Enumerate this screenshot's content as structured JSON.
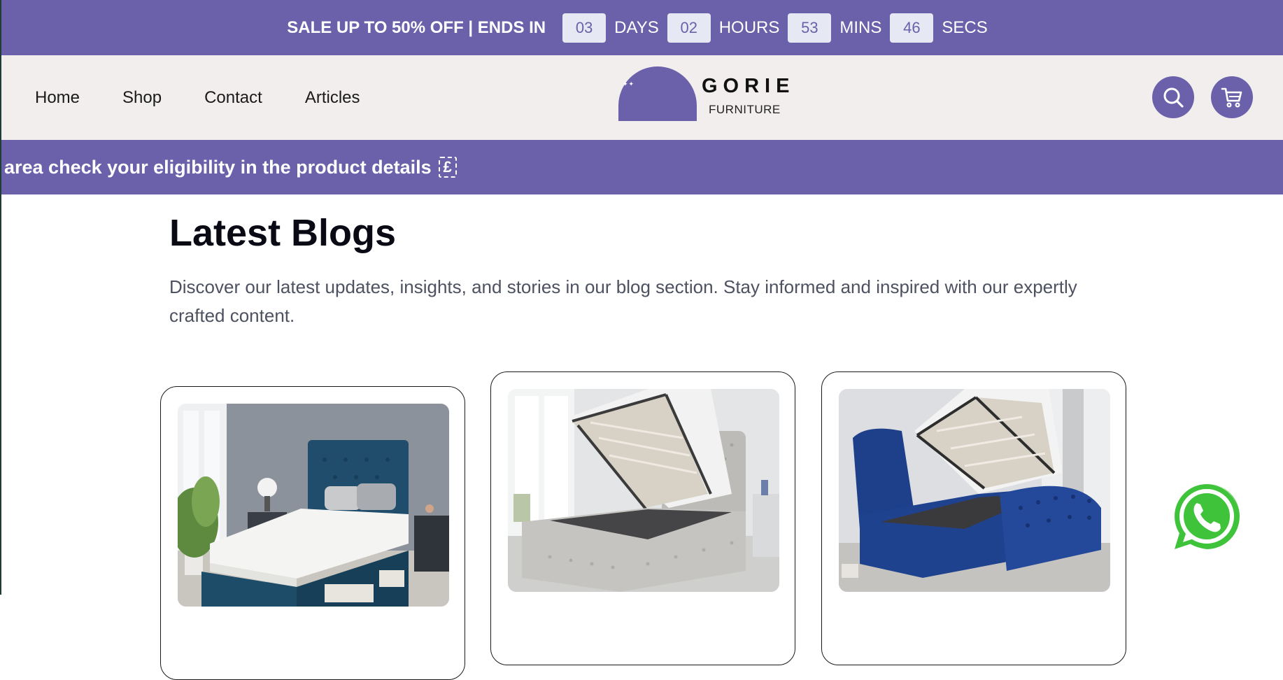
{
  "colors": {
    "brand": "#6b61aa",
    "header_bg": "#f2eeee",
    "timer_box": "#e6e8f3",
    "whatsapp": "#3ec33a"
  },
  "promo": {
    "title": "SALE UP TO 50% OFF | ENDS IN",
    "timer": [
      {
        "value": "03",
        "unit": "DAYS"
      },
      {
        "value": "02",
        "unit": "HOURS"
      },
      {
        "value": "53",
        "unit": "MINS"
      },
      {
        "value": "46",
        "unit": "SECS"
      }
    ]
  },
  "nav": {
    "items": [
      "Home",
      "Shop",
      "Contact",
      "Articles"
    ]
  },
  "logo": {
    "name": "GORIE",
    "sub": "FURNITURE"
  },
  "header_icons": [
    "search-icon",
    "cart-icon"
  ],
  "marquee": {
    "text": "area check your eligibility in the product details",
    "icon": "pound-icon"
  },
  "blog": {
    "title": "Latest Blogs",
    "description": "Discover our latest updates, insights, and stories in our blog section. Stay informed and inspired with our expertly crafted content.",
    "cards": [
      {
        "image": "blue-divan-bed-with-mattress"
      },
      {
        "image": "grey-ottoman-storage-bed-open"
      },
      {
        "image": "blue-chesterfield-ottoman-bed-open"
      }
    ]
  },
  "floating": {
    "icon": "whatsapp-icon"
  }
}
